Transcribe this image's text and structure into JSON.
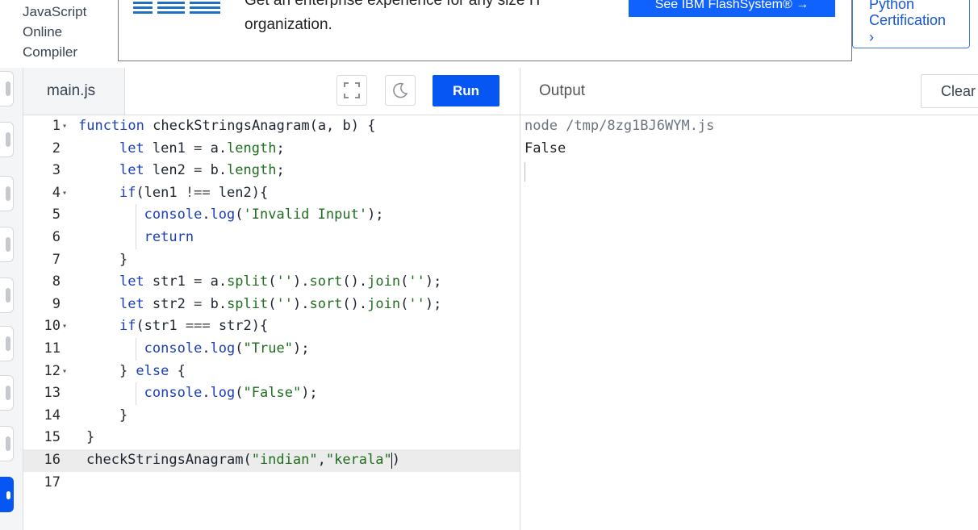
{
  "brand": {
    "lines": [
      "JavaScript",
      "Online",
      "Compiler"
    ]
  },
  "ad": {
    "logo_text": "IBM",
    "text": "Get an enterprise experience for any size IT organization.",
    "cta": "See IBM FlashSystem® →"
  },
  "promo": {
    "text": "Python Certification",
    "chevron": "›"
  },
  "editor": {
    "tab": "main.js",
    "run_label": "Run",
    "lines": [
      "function checkStringsAnagram(a, b) {",
      "    let len1 = a.length;",
      "    let len2 = b.length;",
      "    if(len1 !== len2){",
      "       console.log('Invalid Input');",
      "       return",
      "    }",
      "    let str1 = a.split('').sort().join('');",
      "    let str2 = b.split('').sort().join('');",
      "    if(str1 === str2){",
      "       console.log(\"True\");",
      "    } else {",
      "       console.log(\"False\");",
      "    }",
      "}",
      "checkStringsAnagram(\"indian\",\"kerala\")",
      ""
    ],
    "fold_lines": [
      1,
      4,
      10,
      12
    ],
    "active_line": 16,
    "fold_glyph": "▾"
  },
  "output": {
    "title": "Output",
    "clear_label": "Clear",
    "command": "node /tmp/8zg1BJ6WYM.js",
    "result": "False"
  },
  "colors": {
    "accent": "#0556f3",
    "keyword": "#1a3fb7",
    "string": "#1f6e1f"
  }
}
